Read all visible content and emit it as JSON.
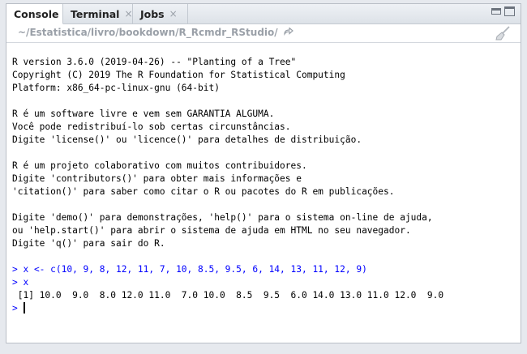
{
  "tabs": [
    {
      "label": "Console",
      "closable": false
    },
    {
      "label": "Terminal",
      "closable": true
    },
    {
      "label": "Jobs",
      "closable": true
    }
  ],
  "path": "~/Estatistica/livro/bookdown/R_Rcmdr_RStudio/",
  "icons": {
    "tab_close": "×",
    "minimize": "minimize-icon",
    "maximize": "maximize-icon",
    "goto": "goto-directory-icon",
    "clear": "broom-icon"
  },
  "console": {
    "lines": [
      {
        "type": "out",
        "text": "R version 3.6.0 (2019-04-26) -- \"Planting of a Tree\""
      },
      {
        "type": "out",
        "text": "Copyright (C) 2019 The R Foundation for Statistical Computing"
      },
      {
        "type": "out",
        "text": "Platform: x86_64-pc-linux-gnu (64-bit)"
      },
      {
        "type": "out",
        "text": ""
      },
      {
        "type": "out",
        "text": "R é um software livre e vem sem GARANTIA ALGUMA."
      },
      {
        "type": "out",
        "text": "Você pode redistribuí-lo sob certas circunstâncias."
      },
      {
        "type": "out",
        "text": "Digite 'license()' ou 'licence()' para detalhes de distribuição."
      },
      {
        "type": "out",
        "text": ""
      },
      {
        "type": "out",
        "text": "R é um projeto colaborativo com muitos contribuidores."
      },
      {
        "type": "out",
        "text": "Digite 'contributors()' para obter mais informações e"
      },
      {
        "type": "out",
        "text": "'citation()' para saber como citar o R ou pacotes do R em publicações."
      },
      {
        "type": "out",
        "text": ""
      },
      {
        "type": "out",
        "text": "Digite 'demo()' para demonstrações, 'help()' para o sistema on-line de ajuda,"
      },
      {
        "type": "out",
        "text": "ou 'help.start()' para abrir o sistema de ajuda em HTML no seu navegador."
      },
      {
        "type": "out",
        "text": "Digite 'q()' para sair do R."
      },
      {
        "type": "out",
        "text": ""
      },
      {
        "type": "inp",
        "text": "> x <- c(10, 9, 8, 12, 11, 7, 10, 8.5, 9.5, 6, 14, 13, 11, 12, 9)"
      },
      {
        "type": "inp",
        "text": "> x"
      },
      {
        "type": "out",
        "text": " [1] 10.0  9.0  8.0 12.0 11.0  7.0 10.0  8.5  9.5  6.0 14.0 13.0 11.0 12.0  9.0"
      }
    ],
    "prompt": "> "
  }
}
